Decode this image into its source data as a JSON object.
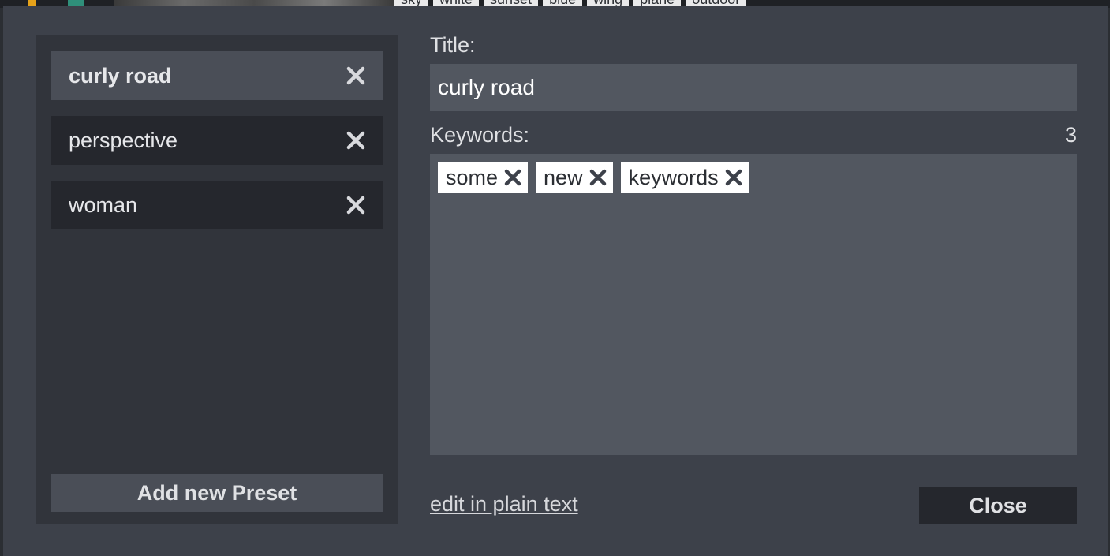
{
  "background": {
    "tags": [
      "sky",
      "white",
      "sunset",
      "blue",
      "wing",
      "plane",
      "outdoor"
    ]
  },
  "presets": {
    "items": [
      {
        "label": "curly road",
        "active": true
      },
      {
        "label": "perspective",
        "active": false
      },
      {
        "label": "woman",
        "active": false
      }
    ],
    "add_label": "Add new Preset"
  },
  "editor": {
    "title_label": "Title:",
    "title_value": "curly road",
    "keywords_label": "Keywords:",
    "keywords_count": "3",
    "keywords": [
      "some",
      "new",
      "keywords"
    ]
  },
  "footer": {
    "plain_text_link": "edit in plain text",
    "close_label": "Close"
  },
  "icons": {
    "remove": "close-icon"
  },
  "colors": {
    "dialog_bg": "#3d414a",
    "panel_bg": "#31343b",
    "active_item": "#4a4e57",
    "item_bg": "#25272d",
    "input_bg": "#525760"
  }
}
